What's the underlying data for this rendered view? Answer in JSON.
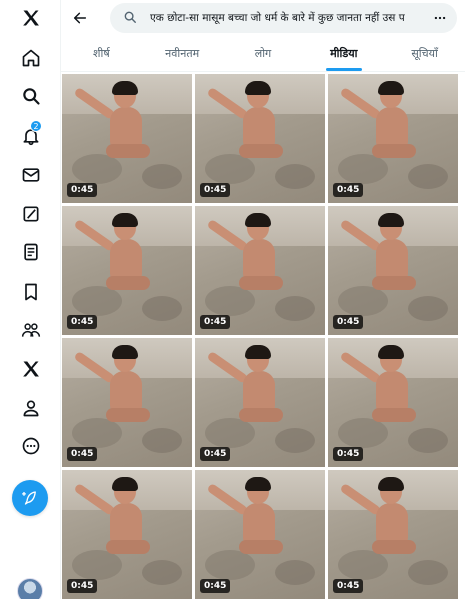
{
  "sidebar": {
    "items": [
      {
        "name": "x-logo-icon"
      },
      {
        "name": "home-icon"
      },
      {
        "name": "search-icon"
      },
      {
        "name": "notifications-icon",
        "badge": "2"
      },
      {
        "name": "messages-icon"
      },
      {
        "name": "grok-icon"
      },
      {
        "name": "lists-icon"
      },
      {
        "name": "bookmarks-icon"
      },
      {
        "name": "communities-icon"
      },
      {
        "name": "premium-x-icon"
      },
      {
        "name": "profile-icon"
      },
      {
        "name": "more-icon"
      }
    ],
    "post_icon": "feather-plus-icon",
    "accent": "#1d9bf0"
  },
  "search": {
    "value": "एक छोटा-सा मासूम बच्चा जो धर्म के बारे में कुछ जानता नहीं उस प"
  },
  "tabs": [
    {
      "label": "शीर्ष"
    },
    {
      "label": "नवीनतम"
    },
    {
      "label": "लोग"
    },
    {
      "label": "मीडिया"
    },
    {
      "label": "सूचियाँ"
    }
  ],
  "active_tab": "मीडिया",
  "media": [
    {
      "duration": "0:45"
    },
    {
      "duration": "0:45"
    },
    {
      "duration": "0:45"
    },
    {
      "duration": "0:45"
    },
    {
      "duration": "0:45"
    },
    {
      "duration": "0:45"
    },
    {
      "duration": "0:45"
    },
    {
      "duration": "0:45"
    },
    {
      "duration": "0:45"
    },
    {
      "duration": "0:45"
    },
    {
      "duration": "0:45"
    },
    {
      "duration": "0:45"
    }
  ]
}
